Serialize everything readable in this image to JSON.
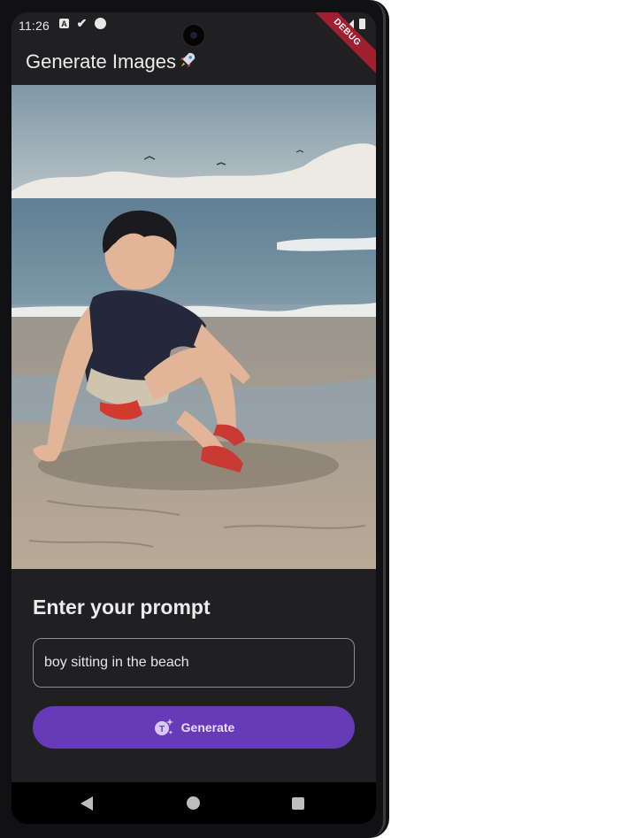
{
  "status_bar": {
    "time": "11:26",
    "debug_label": "DEBUG"
  },
  "app_bar": {
    "title": "Generate Images",
    "title_icon": "rocket-icon"
  },
  "generated_image": {
    "icon": "generated-image-boy-on-beach"
  },
  "prompt": {
    "heading": "Enter your prompt",
    "value": "boy sitting in the beach"
  },
  "generate_button": {
    "label": "Generate",
    "icon": "text-sparkle-icon",
    "color": "#673ab7"
  },
  "nav": {
    "back_icon": "back-icon",
    "home_icon": "home-icon",
    "recents_icon": "recents-icon"
  }
}
